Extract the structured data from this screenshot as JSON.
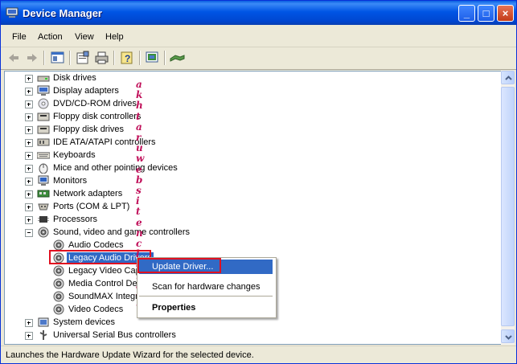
{
  "window": {
    "title": "Device Manager"
  },
  "menu": [
    "File",
    "Action",
    "View",
    "Help"
  ],
  "toolbar": [
    "back-icon",
    "forward-icon",
    "console-tree-icon",
    "properties-icon",
    "print-icon",
    "help-icon",
    "scan-icon",
    "update-driver-icon"
  ],
  "tree": [
    {
      "label": "Disk drives",
      "icon": "disk-drive-icon",
      "level": 1,
      "expander": "plus"
    },
    {
      "label": "Display adapters",
      "icon": "display-adapter-icon",
      "level": 1,
      "expander": "plus"
    },
    {
      "label": "DVD/CD-ROM drives",
      "icon": "dvd-drive-icon",
      "level": 1,
      "expander": "plus"
    },
    {
      "label": "Floppy disk controllers",
      "icon": "floppy-controller-icon",
      "level": 1,
      "expander": "plus"
    },
    {
      "label": "Floppy disk drives",
      "icon": "floppy-drive-icon",
      "level": 1,
      "expander": "plus"
    },
    {
      "label": "IDE ATA/ATAPI controllers",
      "icon": "ide-controller-icon",
      "level": 1,
      "expander": "plus"
    },
    {
      "label": "Keyboards",
      "icon": "keyboard-icon",
      "level": 1,
      "expander": "plus"
    },
    {
      "label": "Mice and other pointing devices",
      "icon": "mouse-icon",
      "level": 1,
      "expander": "plus"
    },
    {
      "label": "Monitors",
      "icon": "monitor-icon",
      "level": 1,
      "expander": "plus"
    },
    {
      "label": "Network adapters",
      "icon": "network-adapter-icon",
      "level": 1,
      "expander": "plus"
    },
    {
      "label": "Ports (COM & LPT)",
      "icon": "port-icon",
      "level": 1,
      "expander": "plus"
    },
    {
      "label": "Processors",
      "icon": "processor-icon",
      "level": 1,
      "expander": "plus"
    },
    {
      "label": "Sound, video and game controllers",
      "icon": "sound-icon",
      "level": 1,
      "expander": "minus"
    },
    {
      "label": "Audio Codecs",
      "icon": "speaker-icon",
      "level": 2
    },
    {
      "label": "Legacy Audio Drivers",
      "icon": "speaker-icon",
      "level": 2,
      "selected": true
    },
    {
      "label": "Legacy Video Capture Devices",
      "icon": "speaker-icon",
      "level": 2
    },
    {
      "label": "Media Control Devices",
      "icon": "speaker-icon",
      "level": 2
    },
    {
      "label": "SoundMAX Integrated Digital Audio",
      "icon": "speaker-icon",
      "level": 2
    },
    {
      "label": "Video Codecs",
      "icon": "speaker-icon",
      "level": 2
    },
    {
      "label": "System devices",
      "icon": "system-device-icon",
      "level": 1,
      "expander": "plus"
    },
    {
      "label": "Universal Serial Bus controllers",
      "icon": "usb-icon",
      "level": 1,
      "expander": "plus"
    }
  ],
  "context_menu": [
    "Update Driver...",
    "Scan for hardware changes",
    "Properties"
  ],
  "status": "Launches the Hardware Update Wizard for the selected device.",
  "watermark": "akhtaruwebsitenclameww",
  "colors": {
    "title_bar": "#0055e5",
    "selection": "#316ac5",
    "highlight_box": "#e01020",
    "watermark": "#c0105a",
    "window_bg": "#ece9d8"
  }
}
